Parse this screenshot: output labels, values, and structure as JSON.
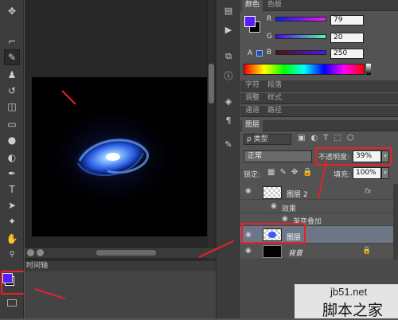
{
  "tools": {
    "icons": [
      "move-icon",
      "brush-icon",
      "eyedropper-icon",
      "stamp-icon",
      "history-brush-icon",
      "eraser-icon",
      "gradient-icon",
      "blur-icon",
      "dodge-icon",
      "pen-icon",
      "type-icon",
      "path-select-icon",
      "shape-icon",
      "hand-icon",
      "zoom-icon"
    ],
    "glyphs": [
      "✥",
      "✎",
      "⌐",
      "♟",
      "↺",
      "◫",
      "▭",
      "●",
      "◐",
      "✒",
      "T",
      "➤",
      "✦",
      "✋",
      "🔍"
    ]
  },
  "color_panel": {
    "tabs": [
      "颜色",
      "色板"
    ],
    "foreground_color": "#5a1cff",
    "background_color": "#000000",
    "r_label": "R",
    "g_label": "G",
    "b_label": "B",
    "r_value": "79",
    "g_value": "20",
    "b_value": "250"
  },
  "char_panel_tabs": [
    "字符",
    "段落"
  ],
  "adjust_panel_tabs": [
    "调整",
    "样式"
  ],
  "channel_panel_tabs": [
    "通道",
    "路径"
  ],
  "layers_panel": {
    "tab": "图层",
    "filter_label": "ρ 类型",
    "blend_mode": "正常",
    "opacity_label": "不透明度:",
    "opacity_value": "39%",
    "lock_label": "锁定:",
    "fill_label": "填充:",
    "fill_value": "100%",
    "layers": [
      {
        "name": "图层 2",
        "fx": "fx"
      },
      {
        "name": "效果"
      },
      {
        "name": "渐变叠加"
      },
      {
        "name": "图层"
      },
      {
        "name": "背景"
      }
    ]
  },
  "timeline_label": "时间轴",
  "watermark": {
    "site": "jb51.net",
    "name": "脚本之家"
  }
}
